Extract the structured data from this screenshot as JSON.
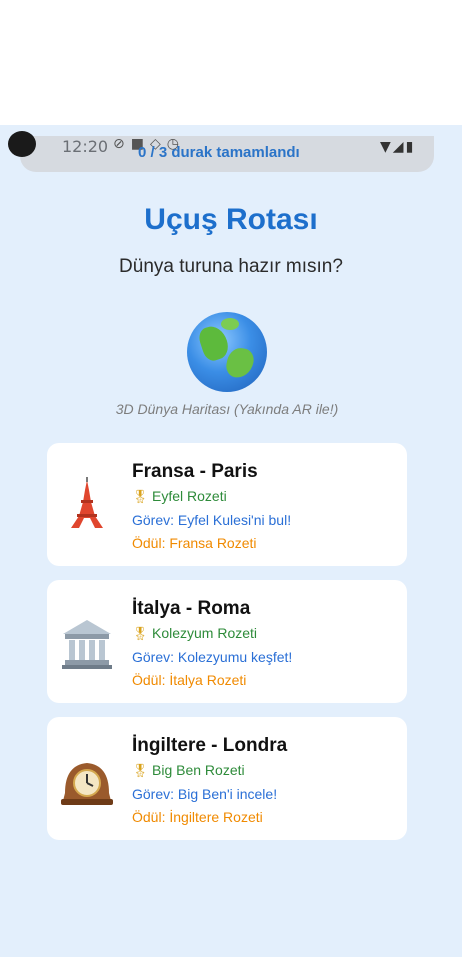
{
  "status_bar": {
    "time": "12:20",
    "icons": [
      "alarm-icon",
      "square-icon",
      "location-icon",
      "clock-icon"
    ],
    "right_icons": [
      "wifi-icon",
      "signal-icon",
      "battery-icon"
    ]
  },
  "progress": {
    "text": "0 / 3 durak tamamlandı",
    "completed": 0,
    "total": 3
  },
  "header": {
    "title": "Uçuş Rotası",
    "subtitle": "Dünya turuna hazır mısın?"
  },
  "globe": {
    "icon": "globe-icon",
    "caption": "3D Dünya Haritası (Yakında AR ile!)"
  },
  "colors": {
    "background": "#e3effc",
    "title": "#1d6fcc",
    "badge": "#2e8b3a",
    "task": "#2a6fd6",
    "reward": "#f08a00"
  },
  "destinations": [
    {
      "icon": "eiffel-tower-icon",
      "title": "Fransa - Paris",
      "badge": "Eyfel Rozeti",
      "task": "Görev: Eyfel Kulesi'ni bul!",
      "reward": "Ödül: Fransa Rozeti"
    },
    {
      "icon": "classical-building-icon",
      "title": "İtalya - Roma",
      "badge": "Kolezyum Rozeti",
      "task": "Görev: Kolezyumu keşfet!",
      "reward": "Ödül: İtalya Rozeti"
    },
    {
      "icon": "mantelpiece-clock-icon",
      "title": "İngiltere - Londra",
      "badge": "Big Ben Rozeti",
      "task": "Görev: Big Ben'i incele!",
      "reward": "Ödül: İngiltere Rozeti"
    }
  ]
}
